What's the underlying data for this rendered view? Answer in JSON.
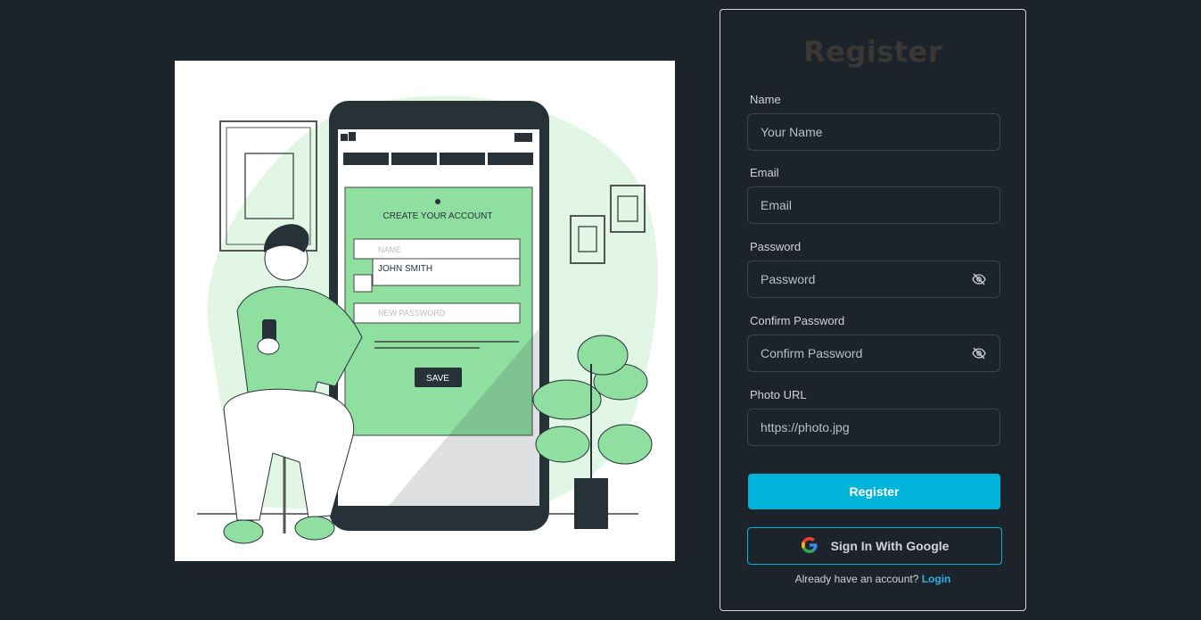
{
  "illustration": {
    "phone_heading": "CREATE YOUR ACCOUNT",
    "field_name_placeholder": "NAME",
    "field_name_value": "JOHN SMITH",
    "field_password_placeholder": "NEW PASSWORD",
    "save_label": "SAVE",
    "accent_color": "#8fdfa0"
  },
  "form": {
    "title": "Register",
    "name": {
      "label": "Name",
      "placeholder": "Your Name"
    },
    "email": {
      "label": "Email",
      "placeholder": "Email"
    },
    "password": {
      "label": "Password",
      "placeholder": "Password",
      "icon": "eye-slash-icon"
    },
    "confirm_password": {
      "label": "Confirm Password",
      "placeholder": "Confirm Password",
      "icon": "eye-slash-icon"
    },
    "photo_url": {
      "label": "Photo URL",
      "placeholder": "https://photo.jpg"
    },
    "register_label": "Register",
    "google_label": "Sign In With Google",
    "footer_text": "Already have an account?",
    "login_label": "Login"
  },
  "colors": {
    "background": "#1d232a",
    "primary": "#00b3d9",
    "link": "#2bb3e6"
  }
}
